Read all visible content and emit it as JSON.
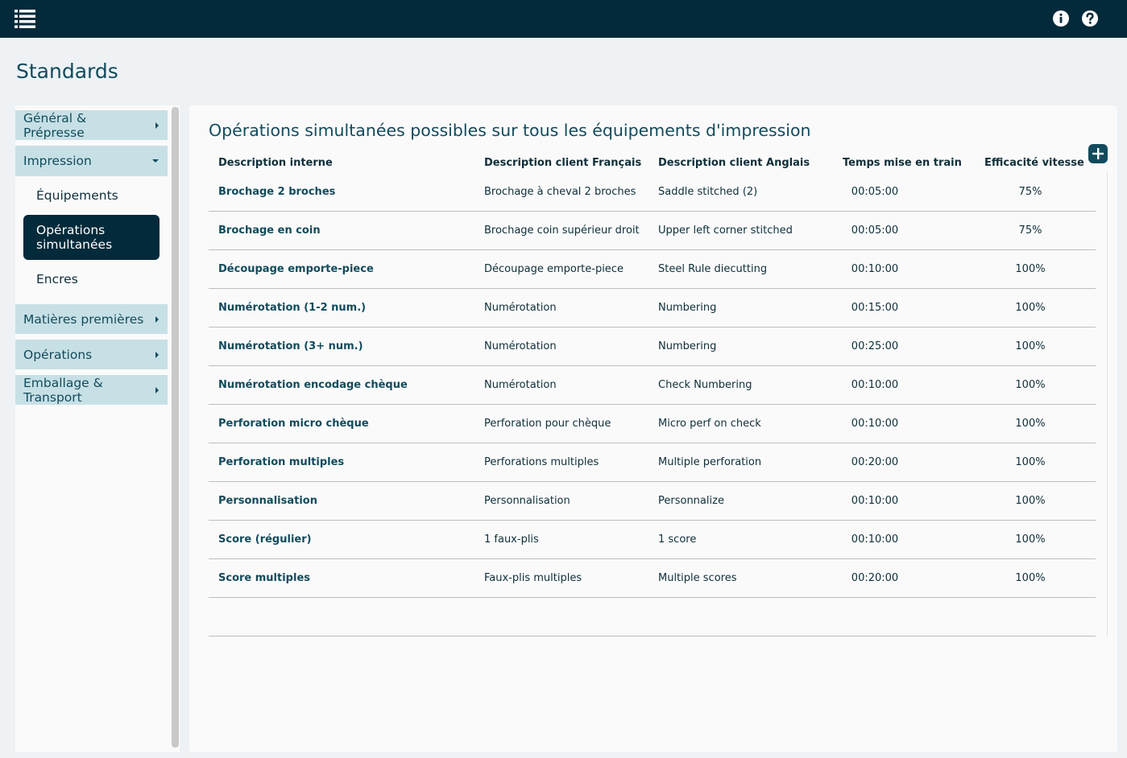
{
  "header": {
    "menu_icon": "list-icon",
    "info_icon": "info-icon",
    "help_icon": "help-icon"
  },
  "page": {
    "title": "Standards"
  },
  "sidebar": {
    "categories": [
      {
        "label": "Général & Prépresse",
        "expanded": false
      },
      {
        "label": "Impression",
        "expanded": true,
        "items": [
          {
            "label": "Équipements",
            "active": false
          },
          {
            "label": "Opérations simultanées",
            "active": true
          },
          {
            "label": "Encres",
            "active": false
          }
        ]
      },
      {
        "label": "Matières premières",
        "expanded": false
      },
      {
        "label": "Opérations",
        "expanded": false
      },
      {
        "label": "Emballage & Transport",
        "expanded": false
      }
    ]
  },
  "main": {
    "title": "Opérations simultanées possibles sur tous les équipements d'impression",
    "add_icon": "plus-icon",
    "columns": [
      "Description interne",
      "Description client Français",
      "Description client Anglais",
      "Temps mise en train",
      "Efficacité vitesse"
    ],
    "rows": [
      [
        "Brochage 2 broches",
        "Brochage à cheval 2 broches",
        "Saddle stitched (2)",
        "00:05:00",
        "75%"
      ],
      [
        "Brochage en coin",
        "Brochage coin supérieur droit",
        "Upper left corner stitched",
        "00:05:00",
        "75%"
      ],
      [
        "Découpage emporte-piece",
        "Découpage emporte-piece",
        "Steel Rule diecutting",
        "00:10:00",
        "100%"
      ],
      [
        "Numérotation (1-2 num.)",
        "Numérotation",
        "Numbering",
        "00:15:00",
        "100%"
      ],
      [
        "Numérotation (3+ num.)",
        "Numérotation",
        "Numbering",
        "00:25:00",
        "100%"
      ],
      [
        "Numérotation encodage chèque",
        "Numérotation",
        "Check Numbering",
        "00:10:00",
        "100%"
      ],
      [
        "Perforation micro chèque",
        "Perforation pour chèque",
        "Micro perf on check",
        "00:10:00",
        "100%"
      ],
      [
        "Perforation multiples",
        "Perforations multiples",
        "Multiple perforation",
        "00:20:00",
        "100%"
      ],
      [
        "Personnalisation",
        "Personnalisation",
        "Personnalize",
        "00:10:00",
        "100%"
      ],
      [
        "Score (régulier)",
        "1 faux-plis",
        "1 score",
        "00:10:00",
        "100%"
      ],
      [
        "Score multiples",
        "Faux-plis multiples",
        "Multiple scores",
        "00:20:00",
        "100%"
      ]
    ]
  },
  "colors": {
    "topbar": "#022a3a",
    "accent": "#124b5c",
    "category_bg": "#c7e0e6"
  }
}
